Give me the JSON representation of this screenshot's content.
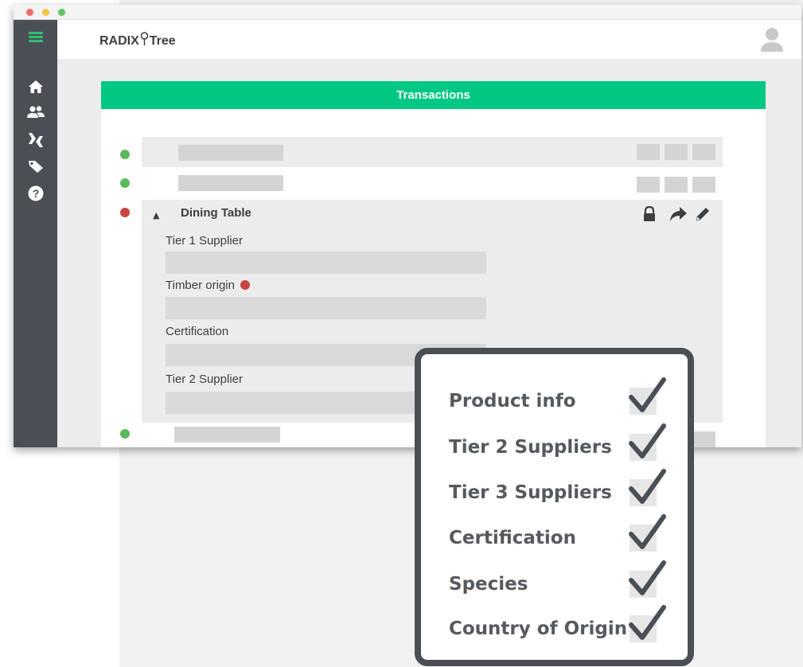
{
  "app": {
    "logo_left": "RADIX",
    "logo_right": "Tree"
  },
  "sidebar": {
    "items": [
      {
        "icon": "home-icon"
      },
      {
        "icon": "users-icon"
      },
      {
        "icon": "transactions-icon"
      },
      {
        "icon": "tag-icon"
      },
      {
        "icon": "help-icon"
      }
    ]
  },
  "card": {
    "title": "Transactions"
  },
  "expanded_row": {
    "title": "Dining Table",
    "status_color": "#c94444",
    "fields": [
      {
        "label": "Tier 1 Supplier",
        "flagged": false
      },
      {
        "label": "Timber origin",
        "flagged": true
      },
      {
        "label": "Certification",
        "flagged": false
      },
      {
        "label": "Tier 2 Supplier",
        "flagged": false
      }
    ]
  },
  "checklist": {
    "items": [
      {
        "label": "Product info",
        "checked": true
      },
      {
        "label": "Tier 2 Suppliers",
        "checked": true
      },
      {
        "label": "Tier 3 Suppliers",
        "checked": true
      },
      {
        "label": "Certification",
        "checked": true
      },
      {
        "label": "Species",
        "checked": true
      },
      {
        "label": "Country of Origin",
        "checked": true
      }
    ]
  },
  "colors": {
    "accent": "#00c882",
    "sidebar": "#4a4f56",
    "ok": "#5cb85c",
    "alert": "#c94444"
  }
}
